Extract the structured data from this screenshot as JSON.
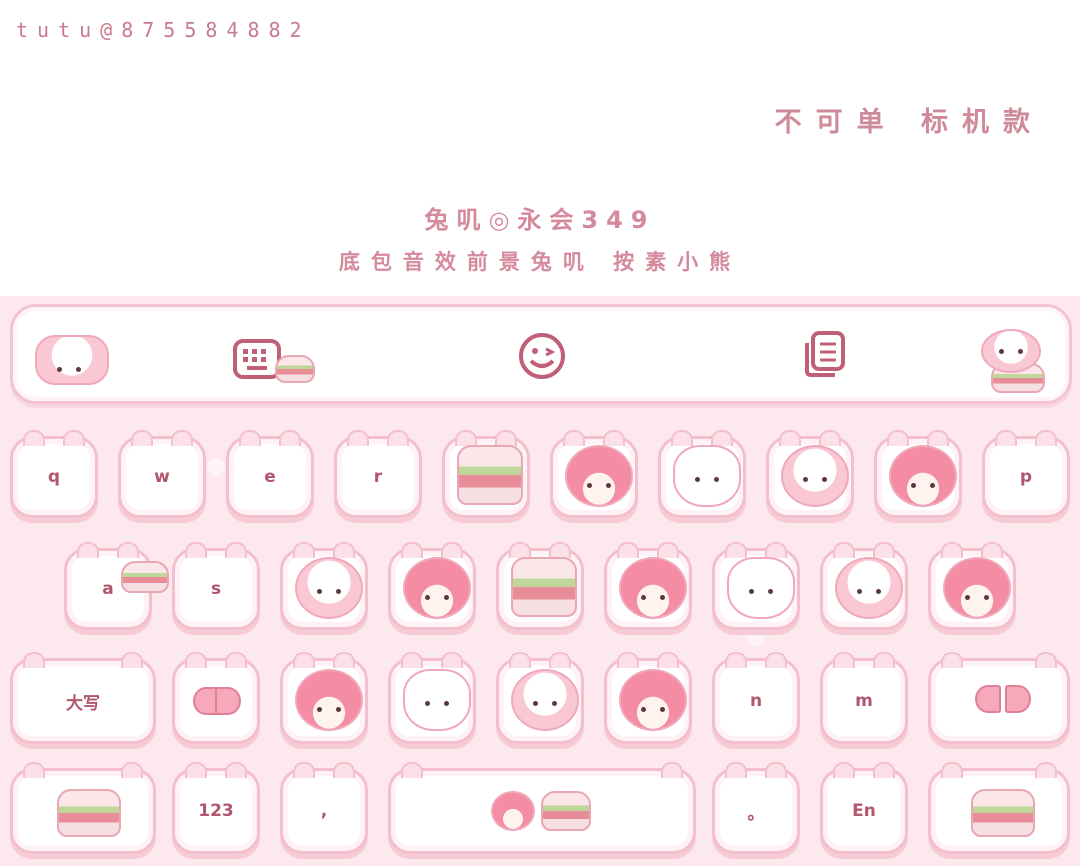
{
  "watermark": "tutu@875584882",
  "tag": "不可单  标机款",
  "title": "兔叽◎永会349",
  "subtitle": "底包音效前景兔叽  按素小熊",
  "toolbar": {
    "icons": [
      "keyboard-icon",
      "emoji-smile-icon",
      "clipboard-icon"
    ]
  },
  "keys": {
    "q": "q",
    "w": "w",
    "e": "e",
    "r": "r",
    "p": "p",
    "a": "a",
    "s": "s",
    "shift": "大写",
    "n": "n",
    "m": "m",
    "num": "123",
    "comma": ",",
    "period": "。",
    "lang": "En"
  },
  "colors": {
    "background": "#fde8ee",
    "key_border": "#f4bfcd",
    "text": "#b0566d",
    "accent": "#d58a9c"
  }
}
